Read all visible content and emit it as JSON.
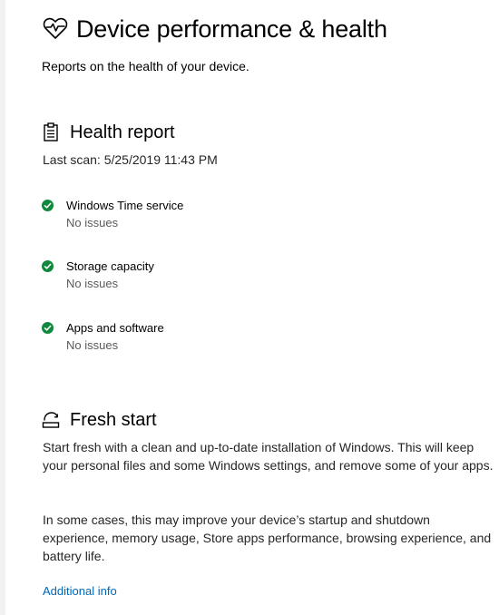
{
  "page": {
    "title": "Device performance & health",
    "subtitle": "Reports on the health of your device."
  },
  "health_report": {
    "title": "Health report",
    "last_scan": "Last scan: 5/25/2019 11:43 PM",
    "items": [
      {
        "name": "Windows Time service",
        "status": "No issues",
        "icon": "check-circle-icon"
      },
      {
        "name": "Storage capacity",
        "status": "No issues",
        "icon": "check-circle-icon"
      },
      {
        "name": "Apps and software",
        "status": "No issues",
        "icon": "check-circle-icon"
      }
    ]
  },
  "fresh_start": {
    "title": "Fresh start",
    "paragraph1": "Start fresh with a clean and up-to-date installation of Windows. This will keep your personal files and some Windows settings, and remove some of your apps.",
    "paragraph2": "In some cases, this may improve your device’s startup and shutdown experience, memory usage, Store apps performance, browsing experience, and battery life.",
    "link": "Additional info"
  },
  "colors": {
    "success": "#10893e",
    "link": "#0067b8"
  }
}
